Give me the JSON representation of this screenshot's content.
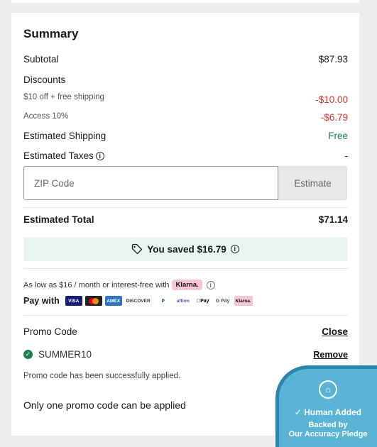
{
  "summary": {
    "title": "Summary",
    "subtotal_label": "Subtotal",
    "subtotal_value": "$87.93",
    "discounts_label": "Discounts",
    "discount1_label": "$10 off + free shipping",
    "discount1_value": "-$10.00",
    "discount2_label": "Access 10%",
    "discount2_value": "-$6.79",
    "shipping_label": "Estimated Shipping",
    "shipping_value": "Free",
    "taxes_label": "Estimated Taxes",
    "taxes_value": "-",
    "zip_placeholder": "ZIP Code",
    "estimate_label": "Estimate",
    "total_label": "Estimated Total",
    "total_value": "$71.14",
    "saved_text": "You saved $16.79"
  },
  "payment": {
    "as_low_text": "As low as $16 / month or interest-free with",
    "klarna_label": "Klarna.",
    "pay_with_label": "Pay with",
    "methods": [
      "VISA",
      "MC",
      "AMEX",
      "DISCOVER",
      "P",
      "affirm",
      "Pay",
      "G Pay",
      "Klarna."
    ]
  },
  "promo": {
    "label": "Promo Code",
    "close_label": "Close",
    "code": "SUMMER10",
    "remove_label": "Remove",
    "success_message": "Promo code has been successfully applied.",
    "one_code_note": "Only one promo code can be applied"
  },
  "badge": {
    "title": "Human Added",
    "line1": "Backed by",
    "line2": "Our Accuracy Pledge"
  },
  "colors": {
    "discount_red": "#d0342c",
    "free_green": "#1a7f4e",
    "saved_bg": "#e9f5ee",
    "klarna_pink": "#f6c6d6",
    "badge_blue": "#5ab4d6"
  }
}
